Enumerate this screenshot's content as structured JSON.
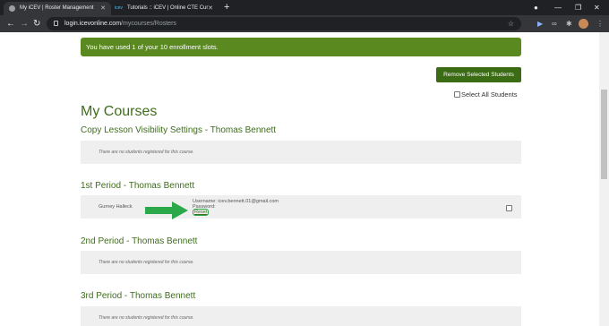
{
  "browser": {
    "tabs": [
      {
        "title": "My iCEV | Roster Management",
        "close": "✕"
      },
      {
        "title": "Tutorials :: iCEV | Online CTE Cur",
        "close": "✕"
      }
    ],
    "new_tab": "+",
    "url": {
      "domain": "login.icevonline.com",
      "path": "/mycourses/Rosters"
    }
  },
  "alert": {
    "text": "You have used 1 of your 10 enrollment slots."
  },
  "actions": {
    "remove_label": "Remove Selected Students",
    "select_all_label": "Select All Students"
  },
  "page_title": "My Courses",
  "courses": [
    {
      "title": "Copy Lesson Visibility Settings - Thomas Bennett",
      "empty_text": "There are no students registered for this course."
    },
    {
      "title": "1st Period - Thomas Bennett",
      "student": {
        "name": "Gurney Halleck",
        "username": "Username: icev.bennett.01@gmail.com",
        "password": "Password:",
        "reset": "Reset"
      }
    },
    {
      "title": "2nd Period - Thomas Bennett",
      "empty_text": "There are no students registered for this course."
    },
    {
      "title": "3rd Period - Thomas Bennett",
      "empty_text": "There are no students registered for this course."
    }
  ],
  "colors": {
    "accent": "#3f6d1c",
    "alert_bg": "#5a8a1f",
    "button_bg": "#3c6b16",
    "arrow": "#2aa84a"
  }
}
